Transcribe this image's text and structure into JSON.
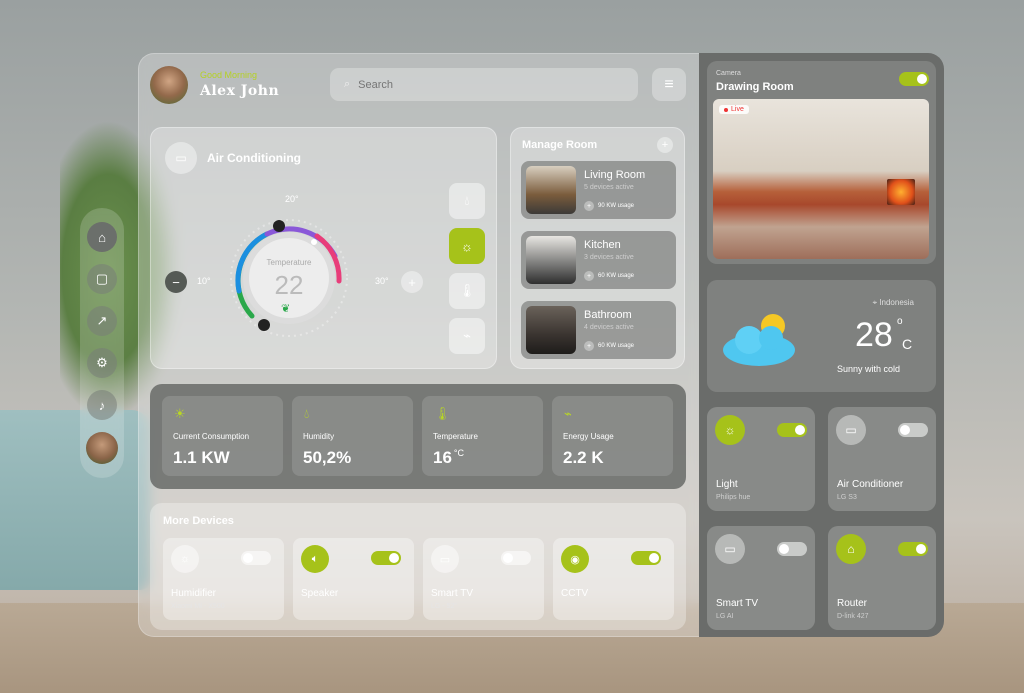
{
  "header": {
    "greeting": "Good Morning",
    "user_name": "Alex John",
    "search_placeholder": "Search"
  },
  "sidebar": {
    "items": [
      {
        "icon": "home-icon"
      },
      {
        "icon": "devices-icon"
      },
      {
        "icon": "chart-icon"
      },
      {
        "icon": "settings-icon"
      },
      {
        "icon": "bell-icon"
      }
    ]
  },
  "air_conditioning": {
    "title": "Air Conditioning",
    "temperature_label": "Temperature",
    "temperature_value": "22",
    "tick_min": "10°",
    "tick_mid": "20°",
    "tick_max": "30°",
    "minus": "−",
    "plus": "+",
    "modes": [
      {
        "icon": "drop-icon",
        "active": false
      },
      {
        "icon": "sun-icon",
        "active": true
      },
      {
        "icon": "thermometer-icon",
        "active": false
      },
      {
        "icon": "pulse-icon",
        "active": false
      }
    ]
  },
  "manage_room": {
    "title": "Manage Room",
    "add": "+",
    "rooms": [
      {
        "name": "Living Room",
        "sub": "5 devices active",
        "usage": "90 KW usage"
      },
      {
        "name": "Kitchen",
        "sub": "3 devices active",
        "usage": "60 KW usage"
      },
      {
        "name": "Bathroom",
        "sub": "4 devices active",
        "usage": "60 KW usage"
      }
    ]
  },
  "stats": [
    {
      "label": "Current Consumption",
      "value": "1.1 KW",
      "unit": "",
      "icon": "bulb-icon"
    },
    {
      "label": "Humidity",
      "value": "50,2%",
      "unit": "",
      "icon": "drop-icon"
    },
    {
      "label": "Temperature",
      "value": "16",
      "unit": "°C",
      "icon": "thermometer-icon"
    },
    {
      "label": "Energy Usage",
      "value": "2.2 K",
      "unit": "",
      "icon": "pulse-icon"
    }
  ],
  "more_devices": {
    "title": "More Devices",
    "devices": [
      {
        "name": "Humidifier",
        "sub": "Xiaomi MI - X500",
        "on": false,
        "icon": "bulb-icon"
      },
      {
        "name": "Speaker",
        "sub": "",
        "on": true,
        "icon": "speaker-icon"
      },
      {
        "name": "Smart TV",
        "sub": "LG - 52\"",
        "on": false,
        "icon": "tv-icon"
      },
      {
        "name": "CCTV",
        "sub": "",
        "on": true,
        "icon": "cctv-icon"
      }
    ]
  },
  "camera": {
    "label": "Camera",
    "room": "Drawing Room",
    "live": "Live",
    "on": true
  },
  "weather": {
    "location": "Indonesia",
    "temp": "28",
    "degree": "o",
    "unit": "C",
    "desc": "Sunny with cold"
  },
  "right_devices": [
    {
      "name": "Light",
      "sub": "Philips hue",
      "on": true,
      "icon": "bulb-icon"
    },
    {
      "name": "Air Conditioner",
      "sub": "LG S3",
      "on": false,
      "icon": "ac-icon"
    },
    {
      "name": "Smart TV",
      "sub": "LG AI",
      "on": false,
      "icon": "tv-icon"
    },
    {
      "name": "Router",
      "sub": "D-link 427",
      "on": true,
      "icon": "router-icon"
    }
  ],
  "colors": {
    "accent": "#a6c21a",
    "greeting": "#b5d124"
  }
}
